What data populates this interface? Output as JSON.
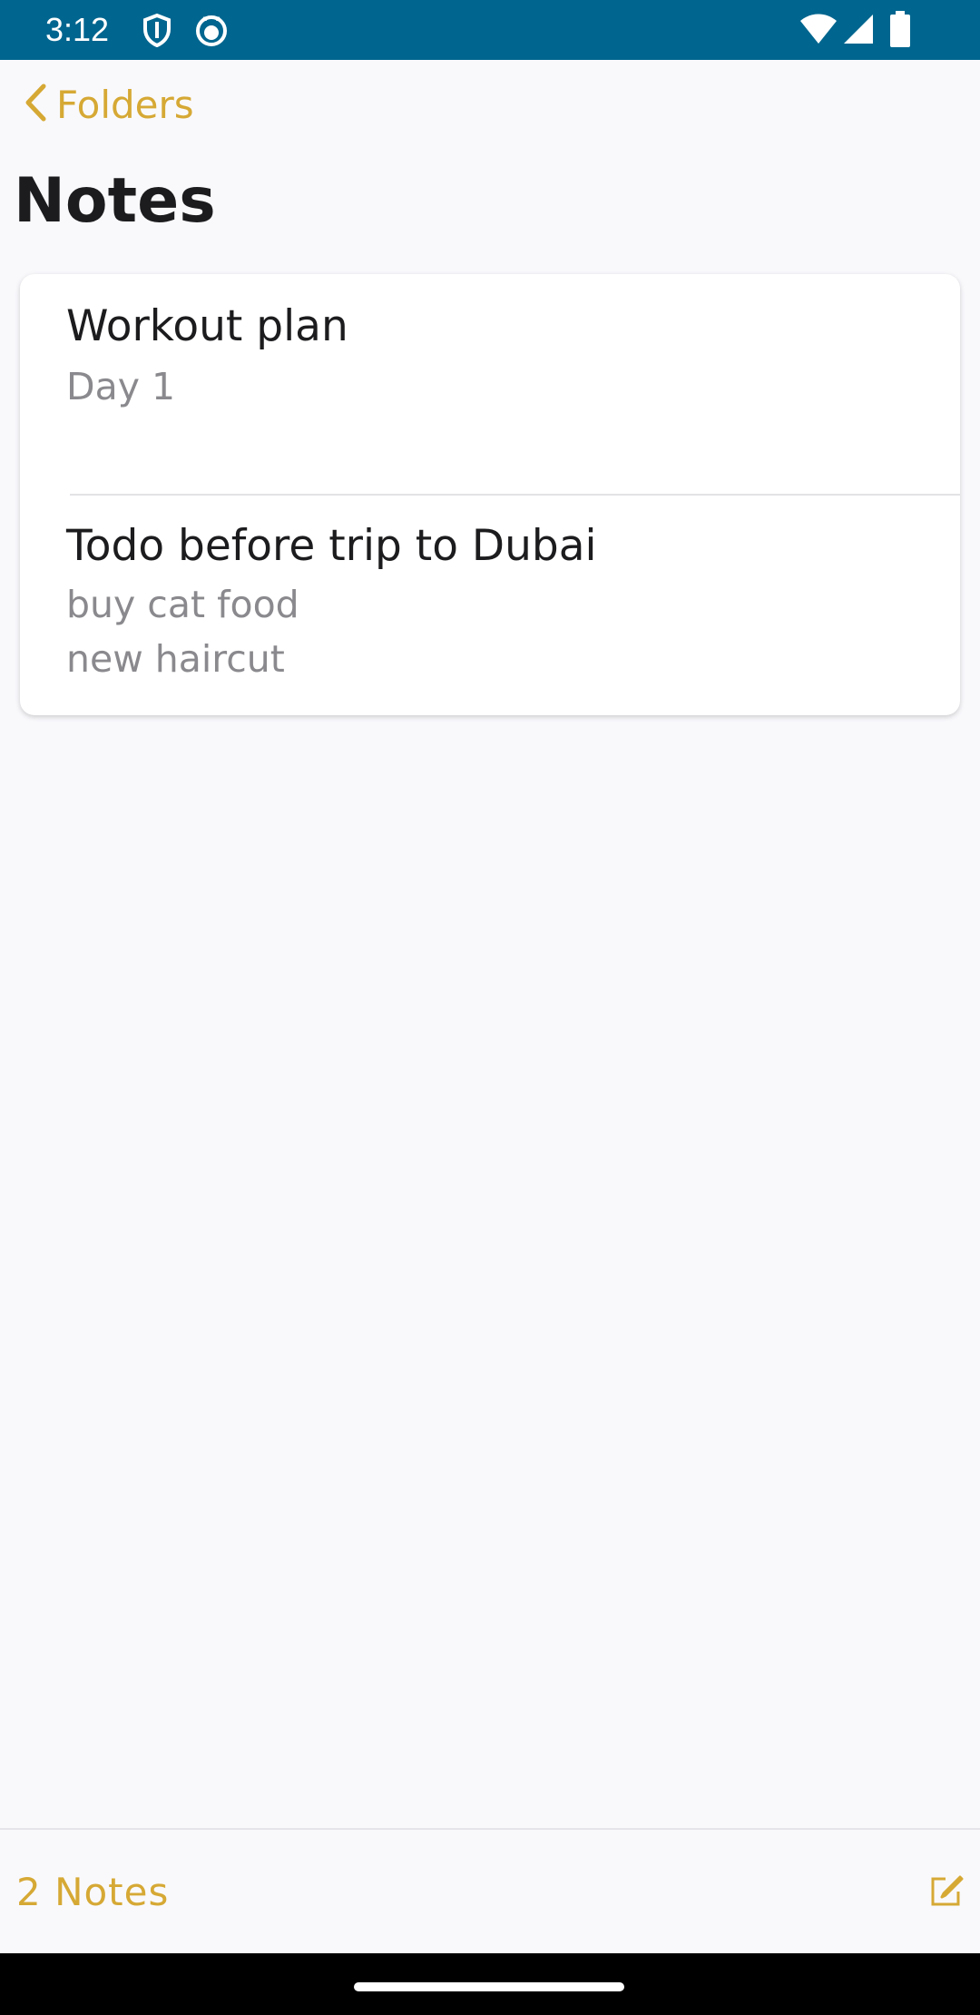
{
  "status_bar": {
    "time": "3:12",
    "left_icons": [
      "shield-icon",
      "cat-face-icon"
    ],
    "right_icons": [
      "wifi-icon",
      "cellular-signal-icon",
      "battery-icon"
    ],
    "background": "#00668f"
  },
  "nav": {
    "back_label": "Folders",
    "back_icon": "chevron-left-icon"
  },
  "page": {
    "title": "Notes"
  },
  "notes": [
    {
      "title": "Workout plan",
      "lines": [
        "Day 1"
      ]
    },
    {
      "title": "Todo before trip to Dubai",
      "lines": [
        "buy cat food",
        "new haircut"
      ]
    }
  ],
  "bottom_bar": {
    "count_label": "2 Notes",
    "compose_icon": "compose-icon"
  },
  "colors": {
    "accent": "#d6a935",
    "background": "#f9f9fc",
    "title": "#1c1c1e",
    "secondary_text": "#8a8a8e"
  }
}
